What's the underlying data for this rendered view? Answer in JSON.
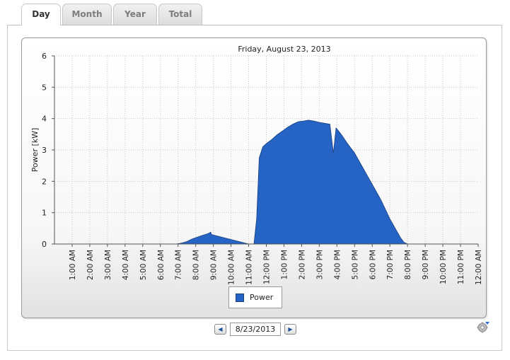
{
  "tabs": [
    {
      "label": "Day",
      "active": true
    },
    {
      "label": "Month",
      "active": false
    },
    {
      "label": "Year",
      "active": false
    },
    {
      "label": "Total",
      "active": false
    }
  ],
  "legend": {
    "label": "Power",
    "color": "#2563c4"
  },
  "date_nav": {
    "prev_icon": "chevron-left-icon",
    "next_icon": "chevron-right-icon",
    "date_value": "8/23/2013"
  },
  "settings_icon": "gear-icon",
  "chart_data": {
    "type": "area",
    "title": "Friday, August 23, 2013",
    "ylabel": "Power [kW]",
    "xlabel": "",
    "ylim": [
      0,
      6
    ],
    "yticks": [
      0,
      1,
      2,
      3,
      4,
      5,
      6
    ],
    "xlim": [
      0,
      24
    ],
    "xticks": [
      "1:00 AM",
      "2:00 AM",
      "3:00 AM",
      "4:00 AM",
      "5:00 AM",
      "6:00 AM",
      "7:00 AM",
      "8:00 AM",
      "9:00 AM",
      "10:00 AM",
      "11:00 AM",
      "12:00 PM",
      "1:00 PM",
      "2:00 PM",
      "3:00 PM",
      "4:00 PM",
      "5:00 PM",
      "6:00 PM",
      "7:00 PM",
      "8:00 PM",
      "9:00 PM",
      "10:00 PM",
      "11:00 PM",
      "12:00 AM"
    ],
    "grid": true,
    "legend_position": "bottom",
    "series": [
      {
        "name": "Power",
        "color": "#2563c4",
        "x": [
          0,
          6.9,
          7.2,
          7.5,
          7.8,
          8.1,
          8.4,
          8.7,
          8.85,
          8.9,
          11.0,
          11.3,
          11.45,
          11.6,
          11.8,
          12.0,
          12.3,
          12.6,
          12.9,
          13.2,
          13.5,
          13.8,
          14.1,
          14.4,
          14.7,
          15.0,
          15.3,
          15.6,
          15.8,
          15.95,
          16.1,
          16.3,
          16.6,
          17.0,
          17.5,
          18.0,
          18.5,
          19.0,
          19.3,
          19.6,
          19.8,
          20.0,
          20.2,
          24.0
        ],
        "y": [
          0,
          0,
          0.03,
          0.08,
          0.16,
          0.22,
          0.28,
          0.33,
          0.38,
          0.3,
          0,
          0,
          0.8,
          2.75,
          3.1,
          3.2,
          3.33,
          3.48,
          3.6,
          3.72,
          3.82,
          3.9,
          3.92,
          3.95,
          3.92,
          3.88,
          3.85,
          3.82,
          2.9,
          3.7,
          3.6,
          3.45,
          3.2,
          2.9,
          2.4,
          1.9,
          1.4,
          0.8,
          0.5,
          0.2,
          0.05,
          0,
          0,
          0
        ]
      }
    ]
  }
}
